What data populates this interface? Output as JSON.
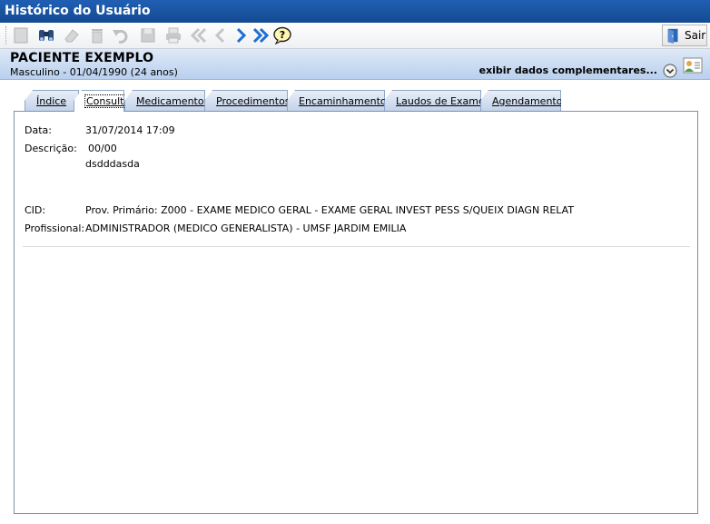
{
  "window": {
    "title": "Histórico do Usuário"
  },
  "toolbar": {
    "icons": [
      "new-icon",
      "binoculars-icon",
      "eraser-icon",
      "trash-icon",
      "undo-icon",
      "save-icon",
      "print-icon",
      "first-record-icon",
      "previous-record-icon",
      "next-record-icon",
      "last-record-icon",
      "help-icon"
    ],
    "exit_label": "Sair"
  },
  "patient": {
    "name": "PACIENTE EXEMPLO",
    "info": "Masculino - 01/04/1990 (24 anos)",
    "extra_link": "exibir dados complementares..."
  },
  "tabs": [
    {
      "label": "Índice",
      "active": false
    },
    {
      "label": "Consultas",
      "active": true
    },
    {
      "label": "Medicamentos",
      "active": false
    },
    {
      "label": "Procedimentos",
      "active": false
    },
    {
      "label": "Encaminhamentos",
      "active": false
    },
    {
      "label": "Laudos de Exames",
      "active": false
    },
    {
      "label": "Agendamentos",
      "active": false
    }
  ],
  "consulta": {
    "date_label": "Data:",
    "date_value": "31/07/2014 17:09",
    "desc_label": "Descrição:",
    "desc_line1": "00/00",
    "desc_line2": "dsdddasda",
    "cid_label": "CID:",
    "cid_value": "Prov. Primário: Z000 - EXAME MEDICO GERAL - EXAME GERAL INVEST PESS S/QUEIX DIAGN RELAT",
    "prof_label": "Profissional:",
    "prof_value": "ADMINISTRADOR (MEDICO GENERALISTA) - UMSF JARDIM EMILIA"
  },
  "colors": {
    "titlebar": "#1f5fb3",
    "patient_band": "#b9d0ee",
    "tab": "#c2d2ea",
    "toolbar_active_icon": "#1e6fd1"
  }
}
